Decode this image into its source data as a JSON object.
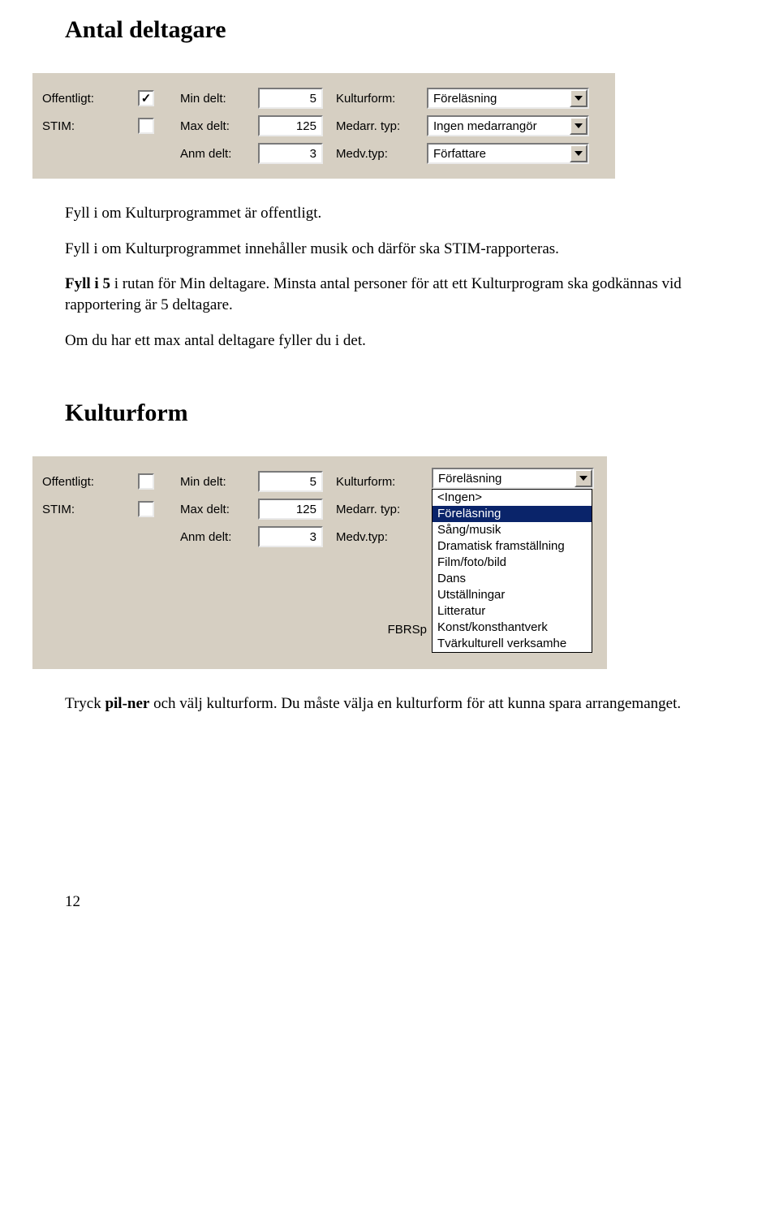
{
  "heading1": "Antal deltagare",
  "para1": "Fyll i om Kulturprogrammet är offentligt.",
  "para2": "Fyll i om Kulturprogrammet innehåller musik och därför ska STIM-rapporteras.",
  "para3_a": "Fyll i 5",
  "para3_b": " i rutan för Min deltagare. Minsta antal personer för att ett Kulturprogram ska godkännas vid rapportering är 5 deltagare.",
  "para4": "Om du har ett max antal deltagare fyller du i det.",
  "heading2": "Kulturform",
  "para5_a": "Tryck ",
  "para5_b": "pil-ner",
  "para5_c": " och välj kulturform. Du måste välja en kulturform för att kunna spara arrangemanget.",
  "page_number": "12",
  "panel1": {
    "offentligt_label": "Offentligt:",
    "offentligt_checked": true,
    "stim_label": "STIM:",
    "stim_checked": false,
    "min_label": "Min delt:",
    "min_value": "5",
    "max_label": "Max delt:",
    "max_value": "125",
    "anm_label": "Anm delt:",
    "anm_value": "3",
    "kulturform_label": "Kulturform:",
    "kulturform_value": "Föreläsning",
    "medarr_label": "Medarr. typ:",
    "medarr_value": "Ingen medarrangör",
    "medv_label": "Medv.typ:",
    "medv_value": "Författare"
  },
  "panel2": {
    "offentligt_label": "Offentligt:",
    "stim_label": "STIM:",
    "min_label": "Min delt:",
    "min_value": "5",
    "max_label": "Max delt:",
    "max_value": "125",
    "anm_label": "Anm delt:",
    "anm_value": "3",
    "kulturform_label": "Kulturform:",
    "kulturform_value": "Föreläsning",
    "medarr_label": "Medarr. typ:",
    "medv_label": "Medv.typ:",
    "fbrsp_label": "FBRSp",
    "options": [
      "<Ingen>",
      "Föreläsning",
      "Sång/musik",
      "Dramatisk framställning",
      "Film/foto/bild",
      "Dans",
      "Utställningar",
      "Litteratur",
      "Konst/konsthantverk",
      "Tvärkulturell verksamhe"
    ],
    "selected_index": 1
  }
}
